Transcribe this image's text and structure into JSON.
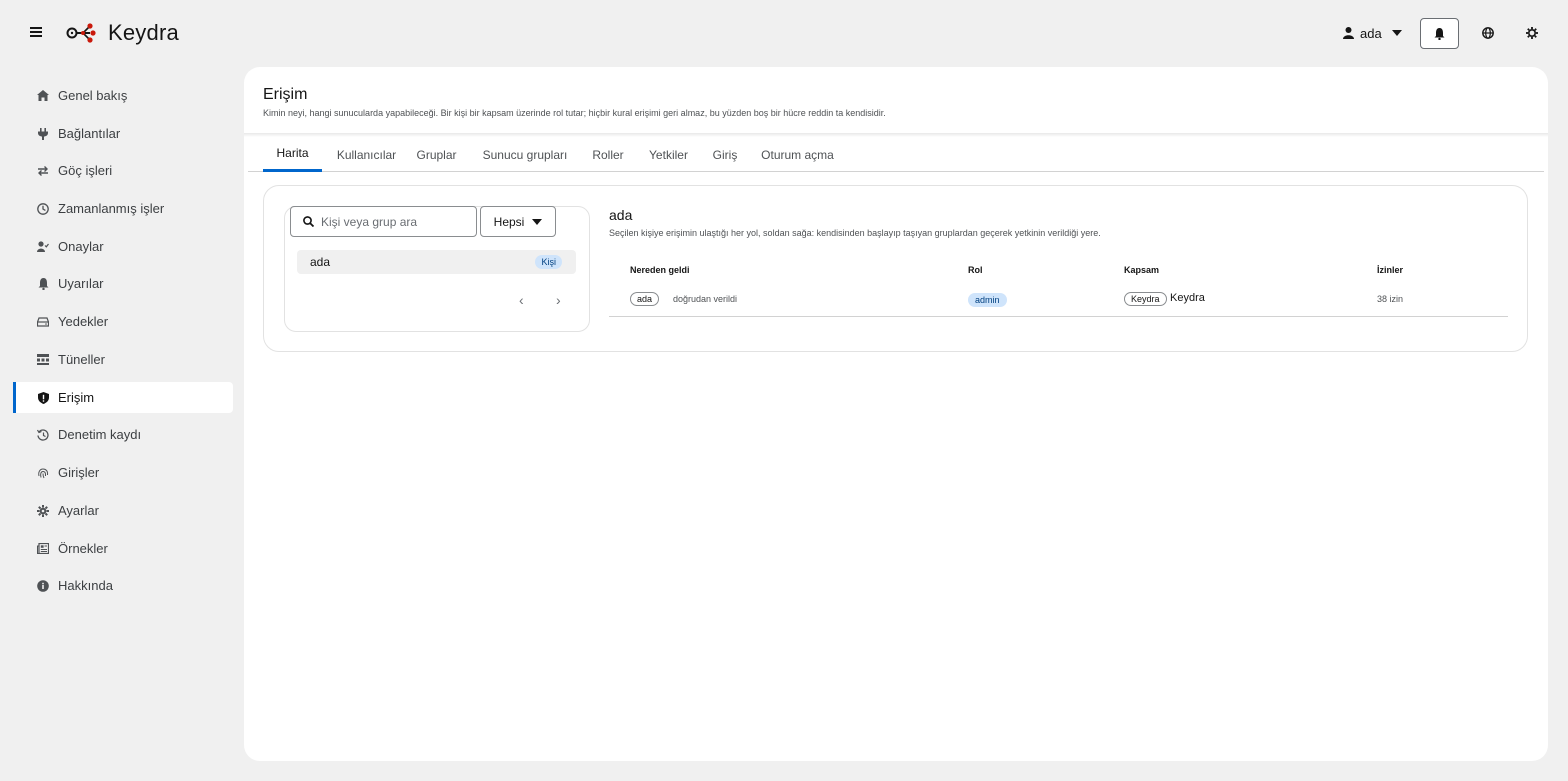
{
  "app": {
    "name": "Keydra"
  },
  "header": {
    "user": "ada"
  },
  "sidebar": {
    "items": [
      {
        "label": "Genel bakış",
        "icon": "home-icon"
      },
      {
        "label": "Bağlantılar",
        "icon": "plug-icon"
      },
      {
        "label": "Göç işleri",
        "icon": "exchange-icon"
      },
      {
        "label": "Zamanlanmış işler",
        "icon": "clock-icon"
      },
      {
        "label": "Onaylar",
        "icon": "user-check-icon"
      },
      {
        "label": "Uyarılar",
        "icon": "bell-icon"
      },
      {
        "label": "Yedekler",
        "icon": "drive-icon"
      },
      {
        "label": "Tüneller",
        "icon": "network-icon"
      },
      {
        "label": "Erişim",
        "icon": "shield-icon",
        "active": true
      },
      {
        "label": "Denetim kaydı",
        "icon": "history-icon"
      },
      {
        "label": "Girişler",
        "icon": "fingerprint-icon"
      },
      {
        "label": "Ayarlar",
        "icon": "gear-icon"
      },
      {
        "label": "Örnekler",
        "icon": "newspaper-icon"
      },
      {
        "label": "Hakkında",
        "icon": "info-icon"
      }
    ]
  },
  "page": {
    "title": "Erişim",
    "description": "Kimin neyi, hangi sunucularda yapabileceği. Bir kişi bir kapsam üzerinde rol tutar; hiçbir kural erişimi geri almaz, bu yüzden boş bir hücre reddin ta kendisidir."
  },
  "tabs": [
    "Harita",
    "Kullanıcılar",
    "Gruplar",
    "Sunucu grupları",
    "Roller",
    "Yetkiler",
    "Giriş",
    "Oturum açma"
  ],
  "active_tab": "Harita",
  "left_panel": {
    "search_placeholder": "Kişi veya grup ara",
    "filter": "Hepsi",
    "items": [
      {
        "name": "ada",
        "type": "Kişi"
      }
    ]
  },
  "detail": {
    "title": "ada",
    "description": "Seçilen kişiye erişimin ulaştığı her yol, soldan sağa: kendisinden başlayıp taşıyan gruplardan geçerek yetkinin verildiği yere.",
    "columns": [
      "Nereden geldi",
      "Rol",
      "Kapsam",
      "İzinler"
    ],
    "rows": [
      {
        "source_pill": "ada",
        "source_text": "doğrudan verildi",
        "role": "admin",
        "scope_pill": "Keydra",
        "scope_text": "Keydra",
        "permissions": "38 izin"
      }
    ]
  },
  "colors": {
    "accent": "#0066cc",
    "badge_bg": "#cfe4fb",
    "logo_red": "#c9190b"
  }
}
